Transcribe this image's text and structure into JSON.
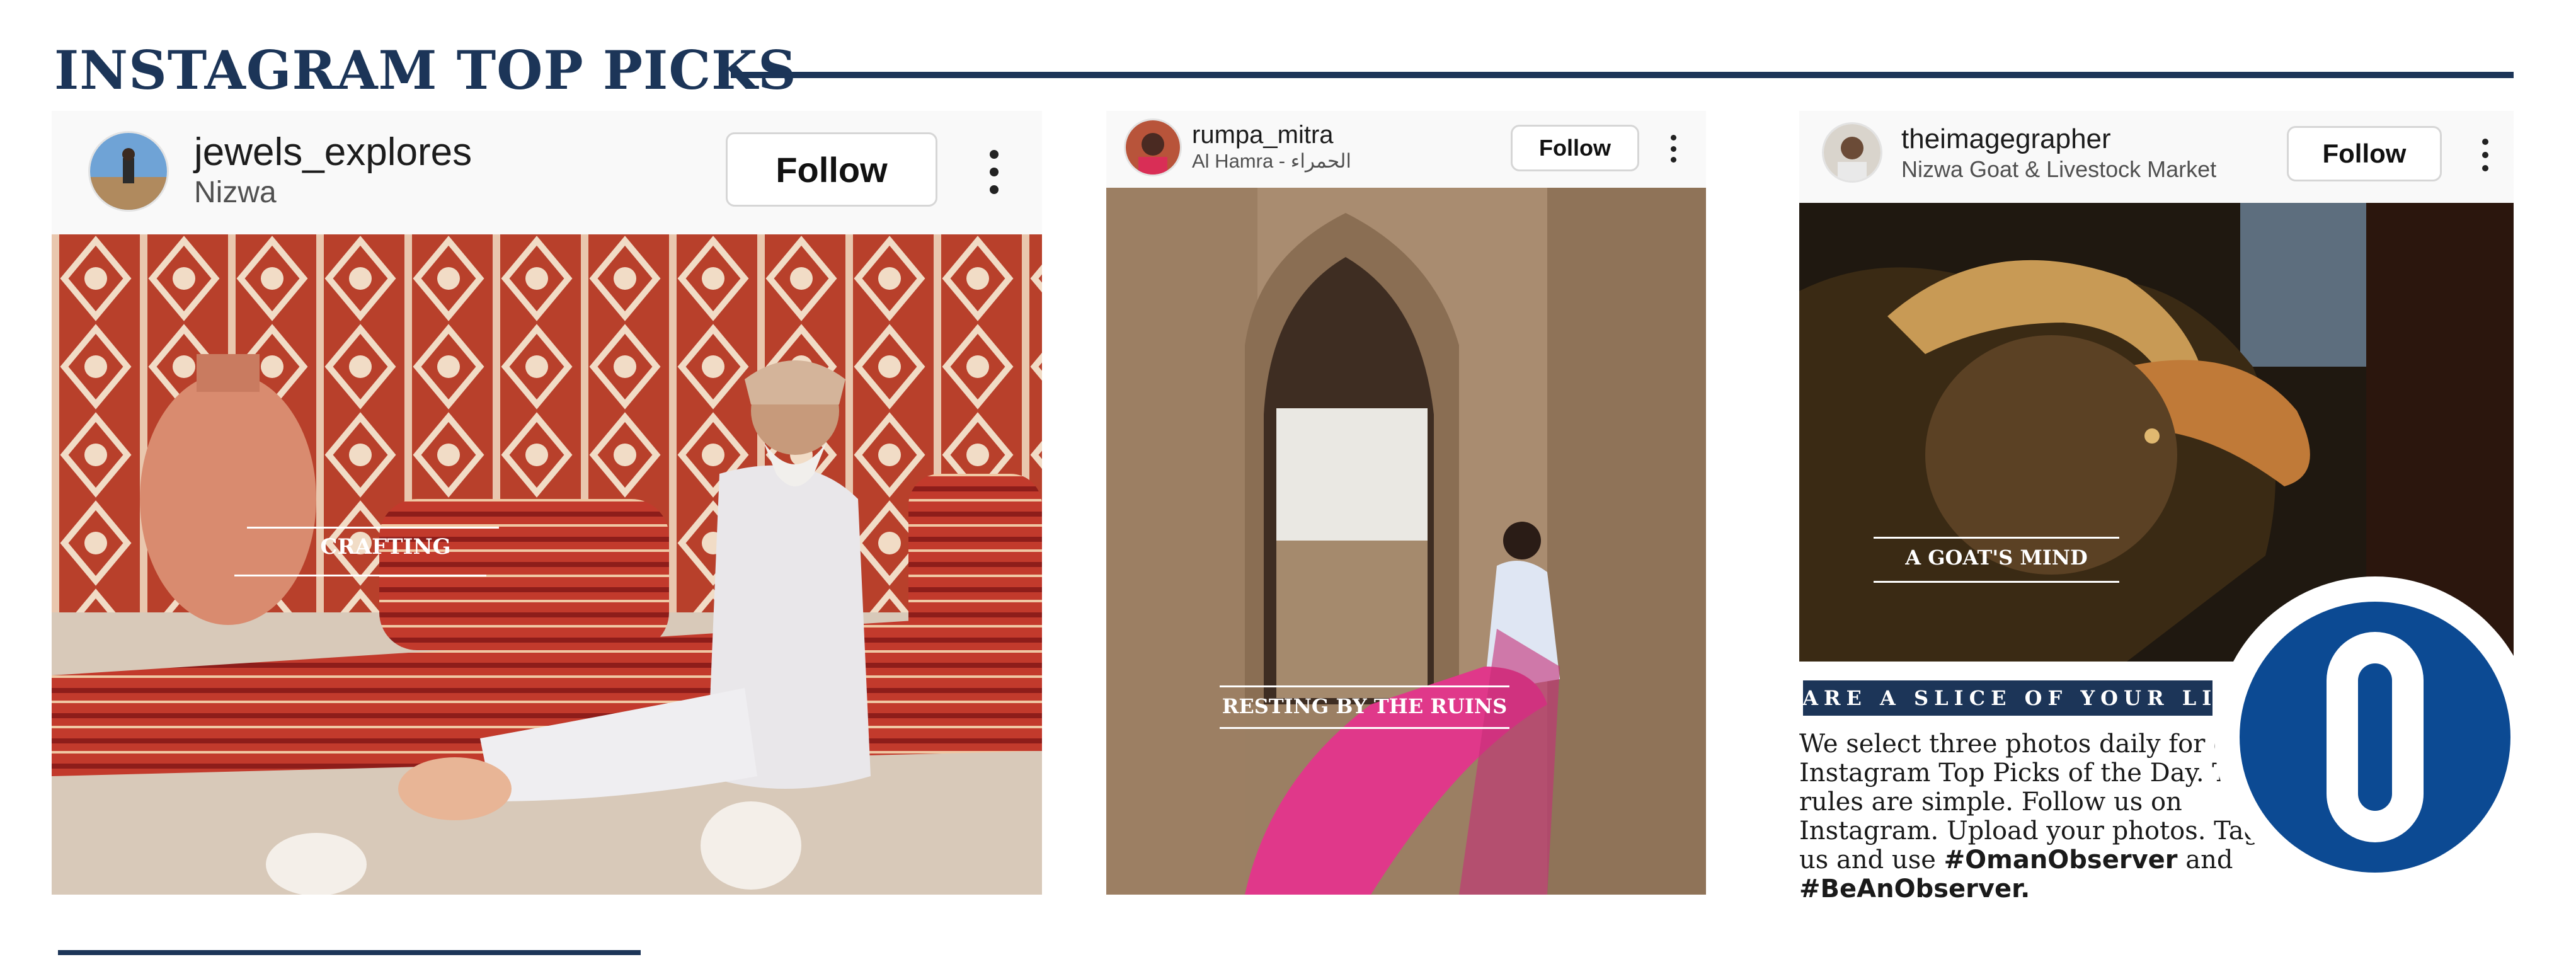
{
  "page": {
    "title": "INSTAGRAM TOP PICKS"
  },
  "posts": [
    {
      "username": "jewels_explores",
      "location": "Nizwa",
      "follow_label": "Follow",
      "caption": "CRAFTING"
    },
    {
      "username": "rumpa_mitra",
      "location": "Al Hamra - الحمراء",
      "follow_label": "Follow",
      "caption": "RESTING BY THE RUINS"
    },
    {
      "username": "theimagegrapher",
      "location": "Nizwa Goat & Livestock Market",
      "follow_label": "Follow",
      "caption": "A GOAT'S MIND"
    }
  ],
  "share": {
    "banner": "SHARE A SLICE OF YOUR LIFE",
    "body": "We select three photos daily for our Instagram Top Picks of the Day. The rules are simple. Follow us on Instagram. Upload your photos. Tag us and use",
    "hashtag1": "#OmanObserver",
    "joiner": "and",
    "hashtag2": "#BeAnObserver",
    "end": "."
  },
  "colors": {
    "brand_navy": "#1c3558",
    "logo_blue": "#0c4a93"
  },
  "icons": [
    "more-options-icon",
    "observer-logo-icon"
  ]
}
